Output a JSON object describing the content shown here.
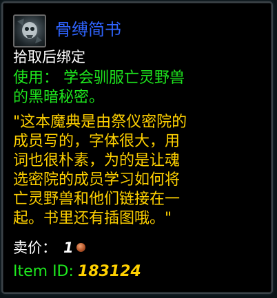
{
  "item": {
    "icon": "book-skull-icon",
    "name": "骨缚简书",
    "bind_text": "拾取后绑定",
    "use_lines": [
      "使用：  学会驯服亡灵野兽",
      "的黑暗秘密。"
    ],
    "flavor_lines": [
      "\"这本魔典是由祭仪密院的",
      "成员写的，字体很大，用",
      "词也很朴素，为的是让魂",
      "选密院的成员学习如何将",
      "亡灵野兽和他们链接在一",
      "起。书里还有插图哦。\""
    ],
    "sell_label": "卖价：",
    "sell_amount": "1",
    "sell_coin": "copper-coin-icon",
    "item_id_label": "Item ID:",
    "item_id_value": "183124"
  },
  "colors": {
    "title": "#2f64ff",
    "bind": "#ffffff",
    "use": "#1ee81e",
    "flavor": "#ffd100",
    "background": "#000000",
    "border": "#3c4348"
  }
}
